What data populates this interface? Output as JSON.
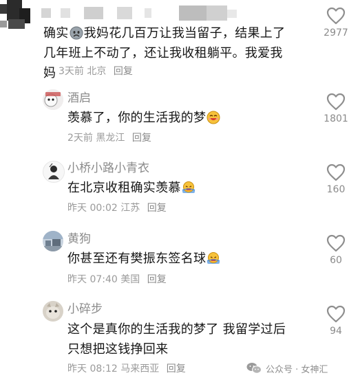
{
  "comments": [
    {
      "username": "",
      "lines": [
        "确实",
        "我妈花几百万让我当留子，结果上了",
        "几年班上不动了，还让我收租躺平。我爱我",
        "妈"
      ],
      "time": "3天前",
      "location": "北京",
      "reply": "回复",
      "likes": "2977"
    },
    {
      "username": "酒启",
      "text": "羡慕了，你的生活我的梦",
      "time": "2天前",
      "location": "黑龙江",
      "reply": "回复",
      "likes": "1801"
    },
    {
      "username": "小桥小路小青衣",
      "text": "在北京收租确实羡慕",
      "time": "昨天 00:02",
      "location": "江苏",
      "reply": "回复",
      "likes": "160"
    },
    {
      "username": "黄狗",
      "text": "你甚至还有樊振东签名球",
      "time": "昨天 07:40",
      "location": "美国",
      "reply": "回复",
      "likes": "60"
    },
    {
      "username": "小碎步",
      "lines": [
        "这个是真你的生活我的梦了 我留学过后",
        "只想把这钱挣回来"
      ],
      "time": "昨天 08:12",
      "location": "马来西亚",
      "reply": "回复",
      "likes": "94"
    }
  ],
  "watermark": "公众号 · 女神汇",
  "icons": {
    "like": "heart-outline-icon",
    "emoji_cry": "crying-face-emoji",
    "emoji_grin": "grinning-face-emoji",
    "emoji_sweat": "sweating-face-emoji",
    "wechat": "wechat-logo-icon"
  }
}
